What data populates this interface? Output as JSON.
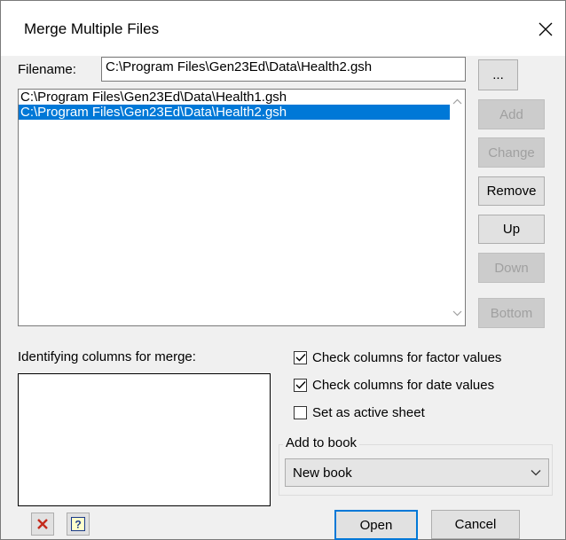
{
  "window": {
    "title": "Merge Multiple Files"
  },
  "filename": {
    "label": "Filename:",
    "value": "C:\\Program Files\\Gen23Ed\\Data\\Health2.gsh",
    "browse_label": "..."
  },
  "file_list": {
    "items": [
      {
        "text": "C:\\Program Files\\Gen23Ed\\Data\\Health1.gsh",
        "selected": false
      },
      {
        "text": "C:\\Program Files\\Gen23Ed\\Data\\Health2.gsh",
        "selected": true
      }
    ]
  },
  "side_buttons": {
    "add": "Add",
    "change": "Change",
    "remove": "Remove",
    "up": "Up",
    "down": "Down",
    "bottom": "Bottom"
  },
  "identifying": {
    "label": "Identifying columns for merge:"
  },
  "options": {
    "factor": {
      "label": "Check columns for factor values",
      "checked": true
    },
    "date": {
      "label": "Check columns for date values",
      "checked": true
    },
    "active": {
      "label": "Set as active sheet",
      "checked": false
    }
  },
  "book": {
    "group_label": "Add to book",
    "selected": "New book"
  },
  "footer": {
    "open": "Open",
    "cancel": "Cancel"
  },
  "colors": {
    "accent": "#0078d7",
    "danger": "#c42b1c"
  }
}
